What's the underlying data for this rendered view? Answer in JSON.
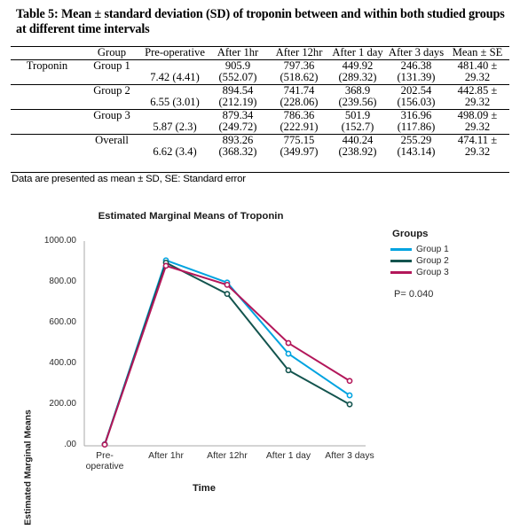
{
  "caption": "Table 5: Mean ± standard deviation (SD) of troponin between and within both studied groups at different time intervals",
  "table": {
    "headers": {
      "analyte": "",
      "group": "Group",
      "pre_operative": "Pre-operative",
      "after_1hr": "After 1hr",
      "after_12hr": "After 12hr",
      "after_1_day": "After 1 day",
      "after_3_days": "After 3 days",
      "mean_se": "Mean ± SE"
    },
    "analyte_label": "Troponin",
    "rows": [
      {
        "group": "Group 1",
        "mean": {
          "pre_operative": "",
          "after_1hr": "905.9",
          "after_12hr": "797.36",
          "after_1_day": "449.92",
          "after_3_days": "246.38"
        },
        "sd": {
          "pre_operative": "7.42 (4.41)",
          "after_1hr": "(552.07)",
          "after_12hr": "(518.62)",
          "after_1_day": "(289.32)",
          "after_3_days": "(131.39)"
        },
        "mean_se_value": "481.40 ±",
        "mean_se_error": "29.32"
      },
      {
        "group": "Group 2",
        "mean": {
          "pre_operative": "",
          "after_1hr": "894.54",
          "after_12hr": "741.74",
          "after_1_day": "368.9",
          "after_3_days": "202.54"
        },
        "sd": {
          "pre_operative": "6.55 (3.01)",
          "after_1hr": "(212.19)",
          "after_12hr": "(228.06)",
          "after_1_day": "(239.56)",
          "after_3_days": "(156.03)"
        },
        "mean_se_value": "442.85 ±",
        "mean_se_error": "29.32"
      },
      {
        "group": "Group 3",
        "mean": {
          "pre_operative": "",
          "after_1hr": "879.34",
          "after_12hr": "786.36",
          "after_1_day": "501.9",
          "after_3_days": "316.96"
        },
        "sd": {
          "pre_operative": "5.87 (2.3)",
          "after_1hr": "(249.72)",
          "after_12hr": "(222.91)",
          "after_1_day": "(152.7)",
          "after_3_days": "(117.86)"
        },
        "mean_se_value": "498.09 ±",
        "mean_se_error": "29.32"
      },
      {
        "group": "Overall",
        "mean": {
          "pre_operative": "",
          "after_1hr": "893.26",
          "after_12hr": "775.15",
          "after_1_day": "440.24",
          "after_3_days": "255.29"
        },
        "sd": {
          "pre_operative": "6.62 (3.4)",
          "after_1hr": "(368.32)",
          "after_12hr": "(349.97)",
          "after_1_day": "(238.92)",
          "after_3_days": "(143.14)"
        },
        "mean_se_value": "474.11 ±",
        "mean_se_error": "29.32"
      }
    ],
    "footnote": "Data are presented as mean ± SD, SE: Standard error"
  },
  "figure": {
    "legend_title": "Groups",
    "p_value": "P= 0.040"
  },
  "chart_data": {
    "type": "line",
    "title": "Estimated Marginal Means of Troponin",
    "xlabel": "Time",
    "ylabel": "Estimated Marginal Means",
    "categories": [
      "Pre-operative",
      "After 1hr",
      "After 12hr",
      "After 1 day",
      "After 3 days"
    ],
    "xtick_labels": [
      "Pre-\noperative",
      "After 1hr",
      "After 12hr",
      "After 1 day",
      "After 3 days"
    ],
    "ytick_labels": [
      "1000.00",
      "800.00",
      "600.00",
      "400.00",
      "200.00",
      ".00"
    ],
    "ytick_values": [
      1000,
      800,
      600,
      400,
      200,
      0
    ],
    "ylim": [
      0,
      1000
    ],
    "grid": false,
    "legend_position": "right",
    "series": [
      {
        "name": "Group 1",
        "color": "#00A3E0",
        "values": [
          7.42,
          905.9,
          797.36,
          449.92,
          246.38
        ]
      },
      {
        "name": "Group 2",
        "color": "#13544E",
        "values": [
          6.55,
          894.54,
          741.74,
          368.9,
          202.54
        ]
      },
      {
        "name": "Group 3",
        "color": "#B3175A",
        "values": [
          5.87,
          879.34,
          786.36,
          501.9,
          316.96
        ]
      }
    ],
    "annotations": [
      "P= 0.040"
    ]
  }
}
